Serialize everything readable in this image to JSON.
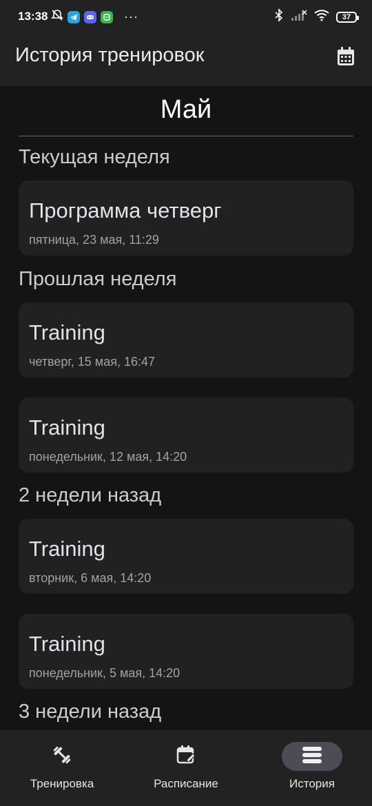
{
  "status_bar": {
    "time": "13:38",
    "battery": "37"
  },
  "app_bar": {
    "title": "История тренировок"
  },
  "month": "Май",
  "groups": [
    {
      "label": "Текущая неделя",
      "items": [
        {
          "title": "Программа четверг",
          "date": "пятница, 23 мая, 11:29"
        }
      ]
    },
    {
      "label": "Прошлая неделя",
      "items": [
        {
          "title": "Training",
          "date": "четверг, 15 мая, 16:47"
        },
        {
          "title": "Training",
          "date": "понедельник, 12 мая, 14:20"
        }
      ]
    },
    {
      "label": "2 недели назад",
      "items": [
        {
          "title": "Training",
          "date": "вторник, 6 мая, 14:20"
        },
        {
          "title": "Training",
          "date": "понедельник, 5 мая, 14:20"
        }
      ]
    },
    {
      "label": "3 недели назад",
      "items": []
    }
  ],
  "bottom_nav": [
    {
      "label": "Тренировка",
      "icon": "dumbbell-icon",
      "active": false
    },
    {
      "label": "Расписание",
      "icon": "calendar-edit-icon",
      "active": false
    },
    {
      "label": "История",
      "icon": "history-list-icon",
      "active": true
    }
  ],
  "colors": {
    "background": "#141414",
    "surface": "#222222",
    "card": "#212121",
    "nav_active": "#4c4c57"
  }
}
